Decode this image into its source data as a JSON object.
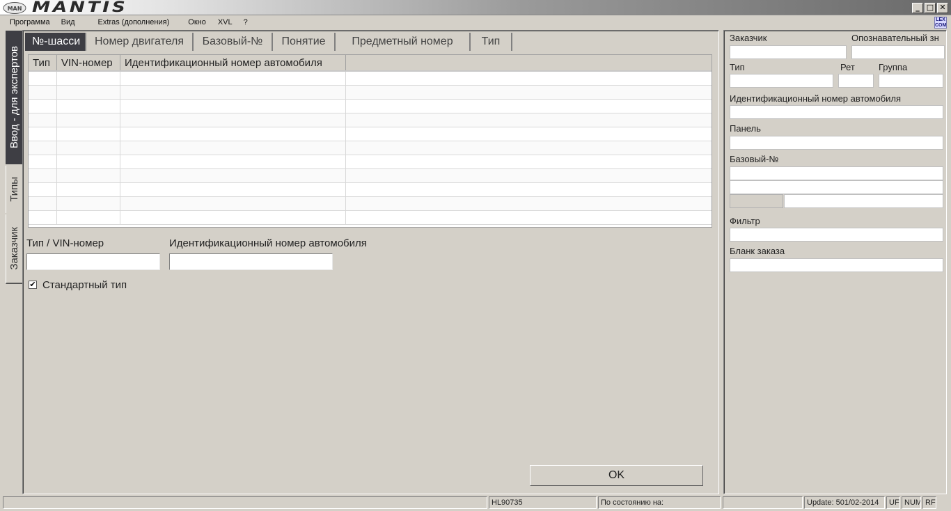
{
  "window": {
    "title": "MANTIS",
    "logo_text": "MAN",
    "controls": {
      "minimize": "_",
      "maximize": "□",
      "close": "✕"
    }
  },
  "menu": [
    "Программа",
    "Вид",
    "Extras (дополнения)",
    "Окно",
    "XVL",
    "?"
  ],
  "lex_icon": "LEX COM",
  "side_tabs": [
    {
      "label": "Ввод - для экспертов",
      "active": true
    },
    {
      "label": "Типы",
      "active": false
    },
    {
      "label": "Заказчик",
      "active": false
    }
  ],
  "tabs": [
    {
      "label": "№-шасси",
      "active": true
    },
    {
      "label": "Номер двигателя",
      "active": false
    },
    {
      "label": "Базовый-№",
      "active": false
    },
    {
      "label": "Понятие",
      "active": false
    },
    {
      "label": "Предметный номер",
      "active": false
    },
    {
      "label": "Тип",
      "active": false
    }
  ],
  "grid": {
    "columns": [
      "Тип",
      "VIN-номер",
      "Идентификационный номер автомобиля",
      ""
    ],
    "rows": []
  },
  "form": {
    "type_vin_label": "Тип / VIN-номер",
    "type_vin_value": "",
    "vehicle_id_label": "Идентификационный номер автомобиля",
    "vehicle_id_value": "",
    "standard_type_label": "Стандартный тип",
    "standard_type_checked": true,
    "ok_label": "OK"
  },
  "right_panel": {
    "customer_label": "Заказчик",
    "ident_label": "Опознавательный зн",
    "type_label": "Тип",
    "ret_label": "Рет",
    "group_label": "Группа",
    "vehicle_id_label": "Идентификационный номер автомобиля",
    "panel_label": "Панель",
    "base_no_label": "Базовый-№",
    "filter_label": "Фильтр",
    "order_form_label": "Бланк заказа"
  },
  "status": {
    "code": "HL90735",
    "as_of": "По состоянию на:",
    "update": "Update: 501/02-2014",
    "uf": "UF",
    "num": "NUM",
    "rf": "RF"
  }
}
